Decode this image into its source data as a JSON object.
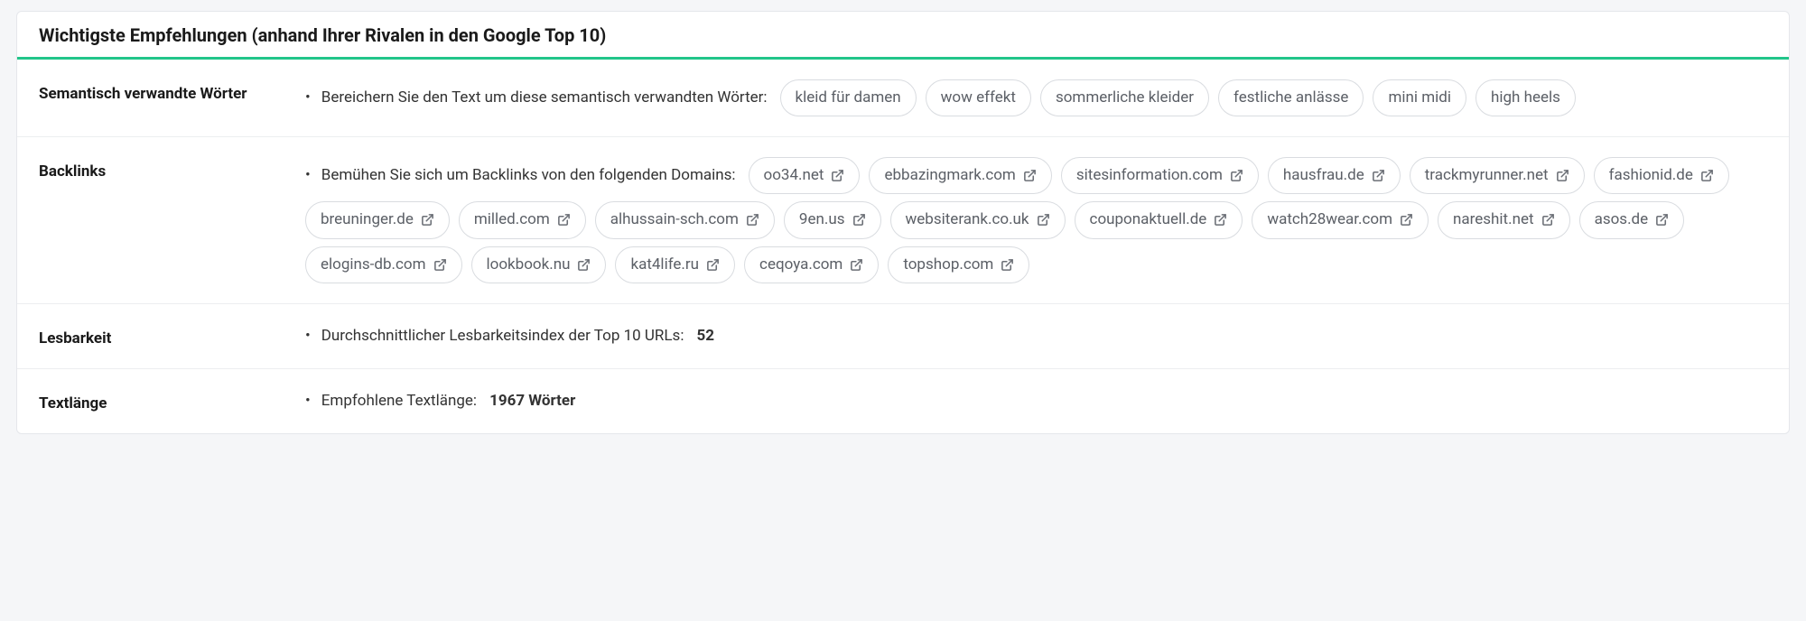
{
  "header": {
    "title": "Wichtigste Empfehlungen (anhand Ihrer Rivalen in den Google Top 10)"
  },
  "sections": {
    "semantic": {
      "label": "Semantisch verwandte Wörter",
      "intro": "Bereichern Sie den Text um diese semantisch verwandten Wörter:",
      "tags": [
        "kleid für damen",
        "wow effekt",
        "sommerliche kleider",
        "festliche anlässe",
        "mini midi",
        "high heels"
      ]
    },
    "backlinks": {
      "label": "Backlinks",
      "intro": "Bemühen Sie sich um Backlinks von den folgenden Domains:",
      "domains": [
        "oo34.net",
        "ebbazingmark.com",
        "sitesinformation.com",
        "hausfrau.de",
        "trackmyrunner.net",
        "fashionid.de",
        "breuninger.de",
        "milled.com",
        "alhussain-sch.com",
        "9en.us",
        "websiterank.co.uk",
        "couponaktuell.de",
        "watch28wear.com",
        "nareshit.net",
        "asos.de",
        "elogins-db.com",
        "lookbook.nu",
        "kat4life.ru",
        "ceqoya.com",
        "topshop.com"
      ]
    },
    "readability": {
      "label": "Lesbarkeit",
      "intro": "Durchschnittlicher Lesbarkeitsindex der Top 10 URLs:",
      "value": "52"
    },
    "textlength": {
      "label": "Textlänge",
      "intro": "Empfohlene Textlänge:",
      "value": "1967 Wörter"
    }
  }
}
